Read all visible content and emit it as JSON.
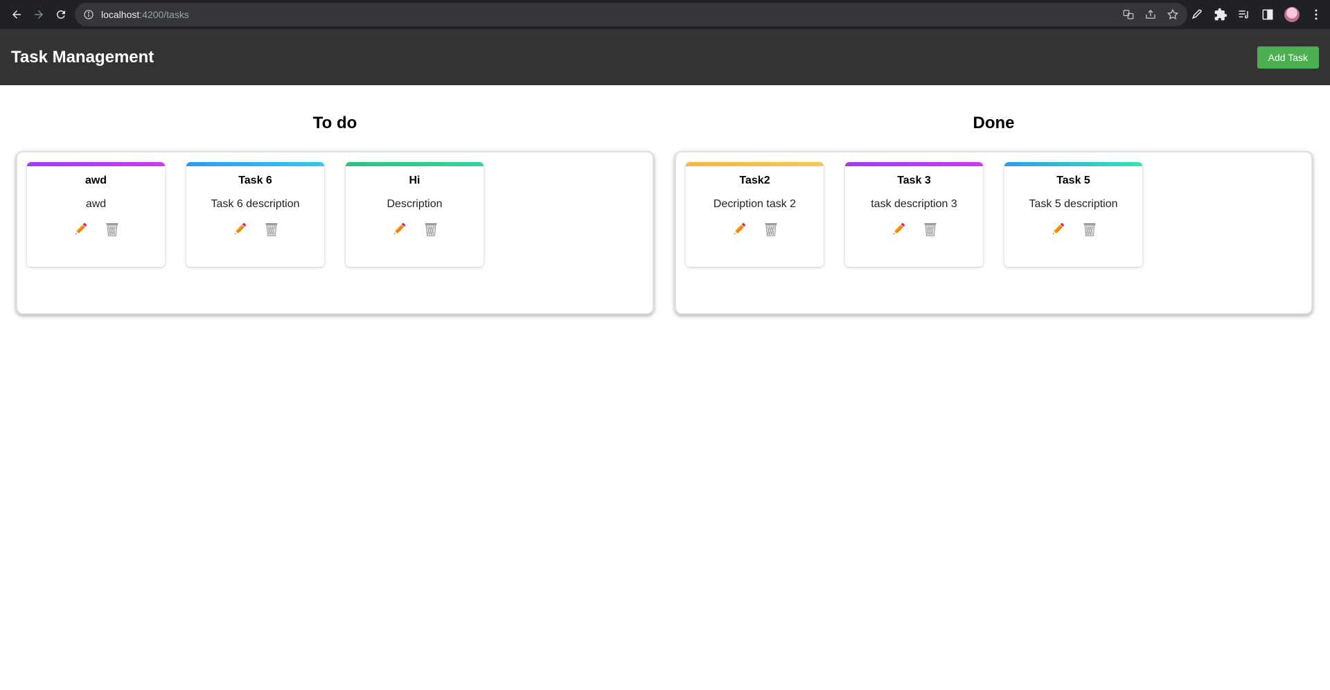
{
  "browser": {
    "url_host": "localhost",
    "url_path": ":4200/tasks"
  },
  "header": {
    "title": "Task Management",
    "add_button_label": "Add Task"
  },
  "columns": [
    {
      "title": "To do",
      "cards": [
        {
          "title": "awd",
          "description": "awd",
          "accent": [
            "#a23cf0",
            "#c83cf0"
          ]
        },
        {
          "title": "Task 6",
          "description": "Task 6 description",
          "accent": [
            "#2f9bf0",
            "#33c7f0"
          ]
        },
        {
          "title": "Hi",
          "description": "Description",
          "accent": [
            "#2ec27e",
            "#33d39a"
          ]
        }
      ]
    },
    {
      "title": "Done",
      "cards": [
        {
          "title": "Task2",
          "description": "Decription task 2",
          "accent": [
            "#f5b73c",
            "#f5c85a"
          ]
        },
        {
          "title": "Task 3",
          "description": "task description 3",
          "accent": [
            "#a23cf0",
            "#c83cf0"
          ]
        },
        {
          "title": "Task 5",
          "description": "Task 5 description",
          "accent": [
            "#2f9bf0",
            "#33e6b0"
          ]
        }
      ]
    }
  ],
  "icons": {
    "edit": "pencil-icon",
    "delete": "trash-can-icon"
  }
}
